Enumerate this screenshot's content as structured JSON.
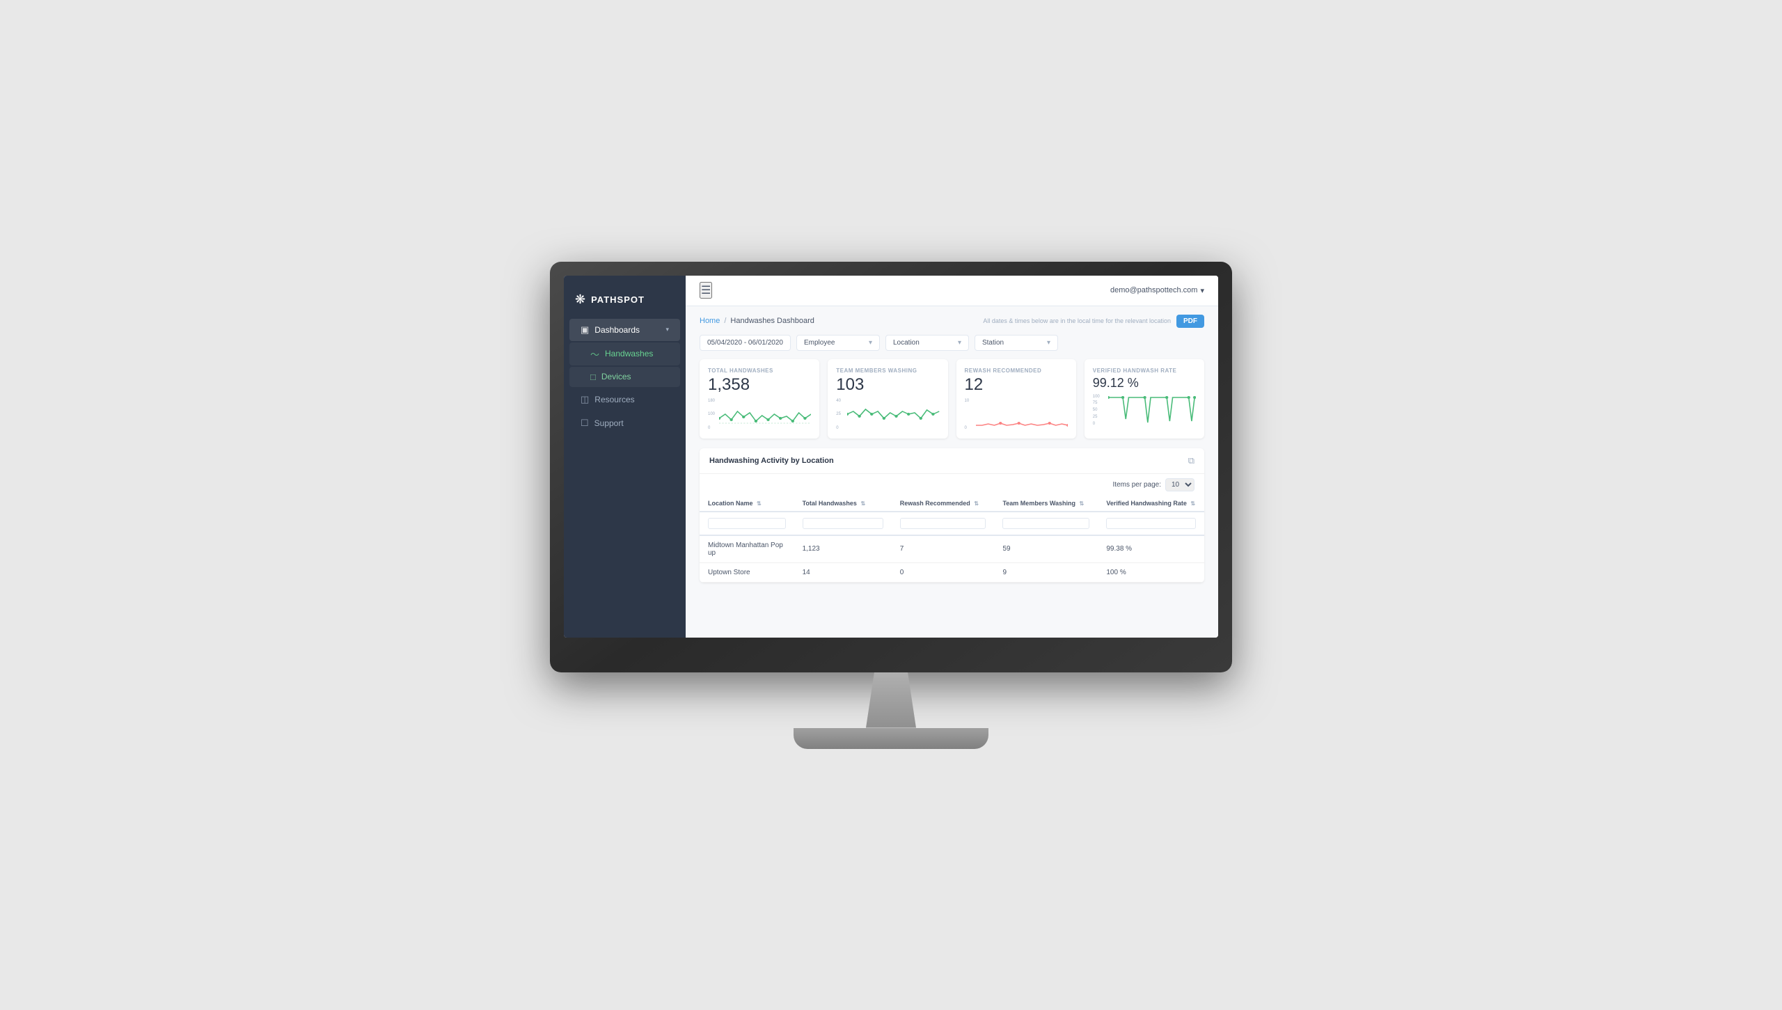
{
  "app": {
    "name": "PATHSPOT",
    "logo_symbol": "❋"
  },
  "header": {
    "hamburger": "☰",
    "user_email": "demo@pathspottech.com",
    "user_arrow": "▾"
  },
  "breadcrumb": {
    "home": "Home",
    "separator": "/",
    "current": "Handwashes Dashboard",
    "date_note": "All dates & times below are in the local time for the relevant location",
    "pdf_label": "PDF"
  },
  "filters": {
    "date_range": "05/04/2020  -  06/01/2020",
    "employee_label": "Employee",
    "location_label": "Location",
    "station_label": "Station"
  },
  "stats": [
    {
      "id": "total-handwashes",
      "label": "TOTAL HANDWASHES",
      "value": "1,358",
      "chart_color": "#48bb78",
      "y_max": "180",
      "y_mid": "100",
      "y_min": "0"
    },
    {
      "id": "team-members",
      "label": "TEAM MEMBERS WASHING",
      "value": "103",
      "chart_color": "#48bb78",
      "y_max": "40",
      "y_mid": "25",
      "y_min": "0"
    },
    {
      "id": "rewash",
      "label": "REWASH RECOMMENDED",
      "value": "12",
      "chart_color": "#fc8181",
      "y_max": "10",
      "y_min": "0"
    },
    {
      "id": "verified-rate",
      "label": "VERIFIED HANDWASH RATE",
      "value": "99.12 %",
      "chart_color": "#48bb78",
      "y_max": "100",
      "y_vals": "75,50,25,0"
    }
  ],
  "table": {
    "title": "Handwashing Activity by Location",
    "items_per_page_label": "Items per page:",
    "items_per_page_value": "10",
    "columns": [
      {
        "key": "location_name",
        "label": "Location Name"
      },
      {
        "key": "total_handwashes",
        "label": "Total Handwashes"
      },
      {
        "key": "rewash_recommended",
        "label": "Rewash Recommended"
      },
      {
        "key": "team_members_washing",
        "label": "Team Members Washing"
      },
      {
        "key": "verified_rate",
        "label": "Verified Handwashing Rate"
      }
    ],
    "rows": [
      {
        "location_name": "Midtown Manhattan Pop up",
        "total_handwashes": "1,123",
        "rewash_recommended": "7",
        "team_members_washing": "59",
        "verified_rate": "99.38 %"
      },
      {
        "location_name": "Uptown Store",
        "total_handwashes": "14",
        "rewash_recommended": "0",
        "team_members_washing": "9",
        "verified_rate": "100 %"
      }
    ]
  },
  "sidebar": {
    "nav_items": [
      {
        "id": "dashboards",
        "label": "Dashboards",
        "icon": "▣",
        "active": true,
        "has_arrow": true
      },
      {
        "id": "handwashes",
        "label": "Handwashes",
        "icon": "〜",
        "sub": true,
        "active": true
      },
      {
        "id": "devices",
        "label": "Devices",
        "icon": "□",
        "sub": true
      },
      {
        "id": "resources",
        "label": "Resources",
        "icon": "◫"
      },
      {
        "id": "support",
        "label": "Support",
        "icon": "☐"
      }
    ]
  }
}
